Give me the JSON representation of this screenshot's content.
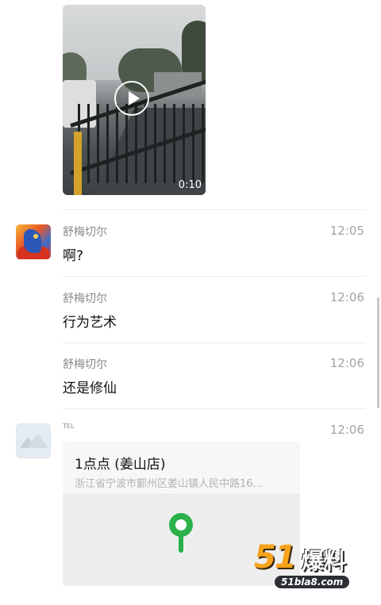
{
  "video": {
    "duration": "0:10"
  },
  "messages": [
    {
      "sender": "舒梅切尔",
      "time": "12:05",
      "text": "啊?"
    },
    {
      "sender": "舒梅切尔",
      "time": "12:06",
      "text": "行为艺术"
    },
    {
      "sender": "舒梅切尔",
      "time": "12:06",
      "text": "还是修仙"
    }
  ],
  "location_message": {
    "sender": "TEL",
    "time": "12:06",
    "title": "1点点 (姜山店)",
    "address": "浙江省宁波市鄞州区姜山镇人民中路16..."
  },
  "watermark": {
    "brand_num": "51",
    "brand_cn": "爆料",
    "url": "51bla8.com"
  }
}
